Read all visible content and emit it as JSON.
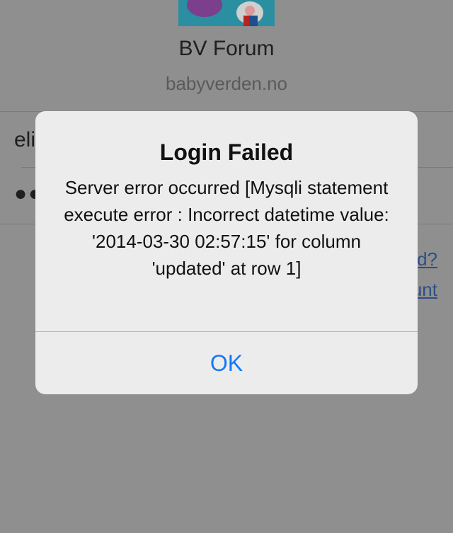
{
  "app": {
    "title": "BV Forum",
    "subtitle": "babyverden.no"
  },
  "login_form": {
    "username_value": "eli",
    "password_value": "●●",
    "forgot_link_fragment": "d?",
    "account_link_fragment": "unt"
  },
  "alert": {
    "title": "Login Failed",
    "message": "Server error occurred [Mysqli statement execute error : Incorrect datetime value: '2014-03-30 02:57:15' for column 'updated' at row 1]",
    "ok_label": "OK"
  },
  "colors": {
    "accent": "#1479f6",
    "link": "#2c4f86",
    "overlay_background": "#8f8f8f",
    "alert_background": "#ececec"
  }
}
